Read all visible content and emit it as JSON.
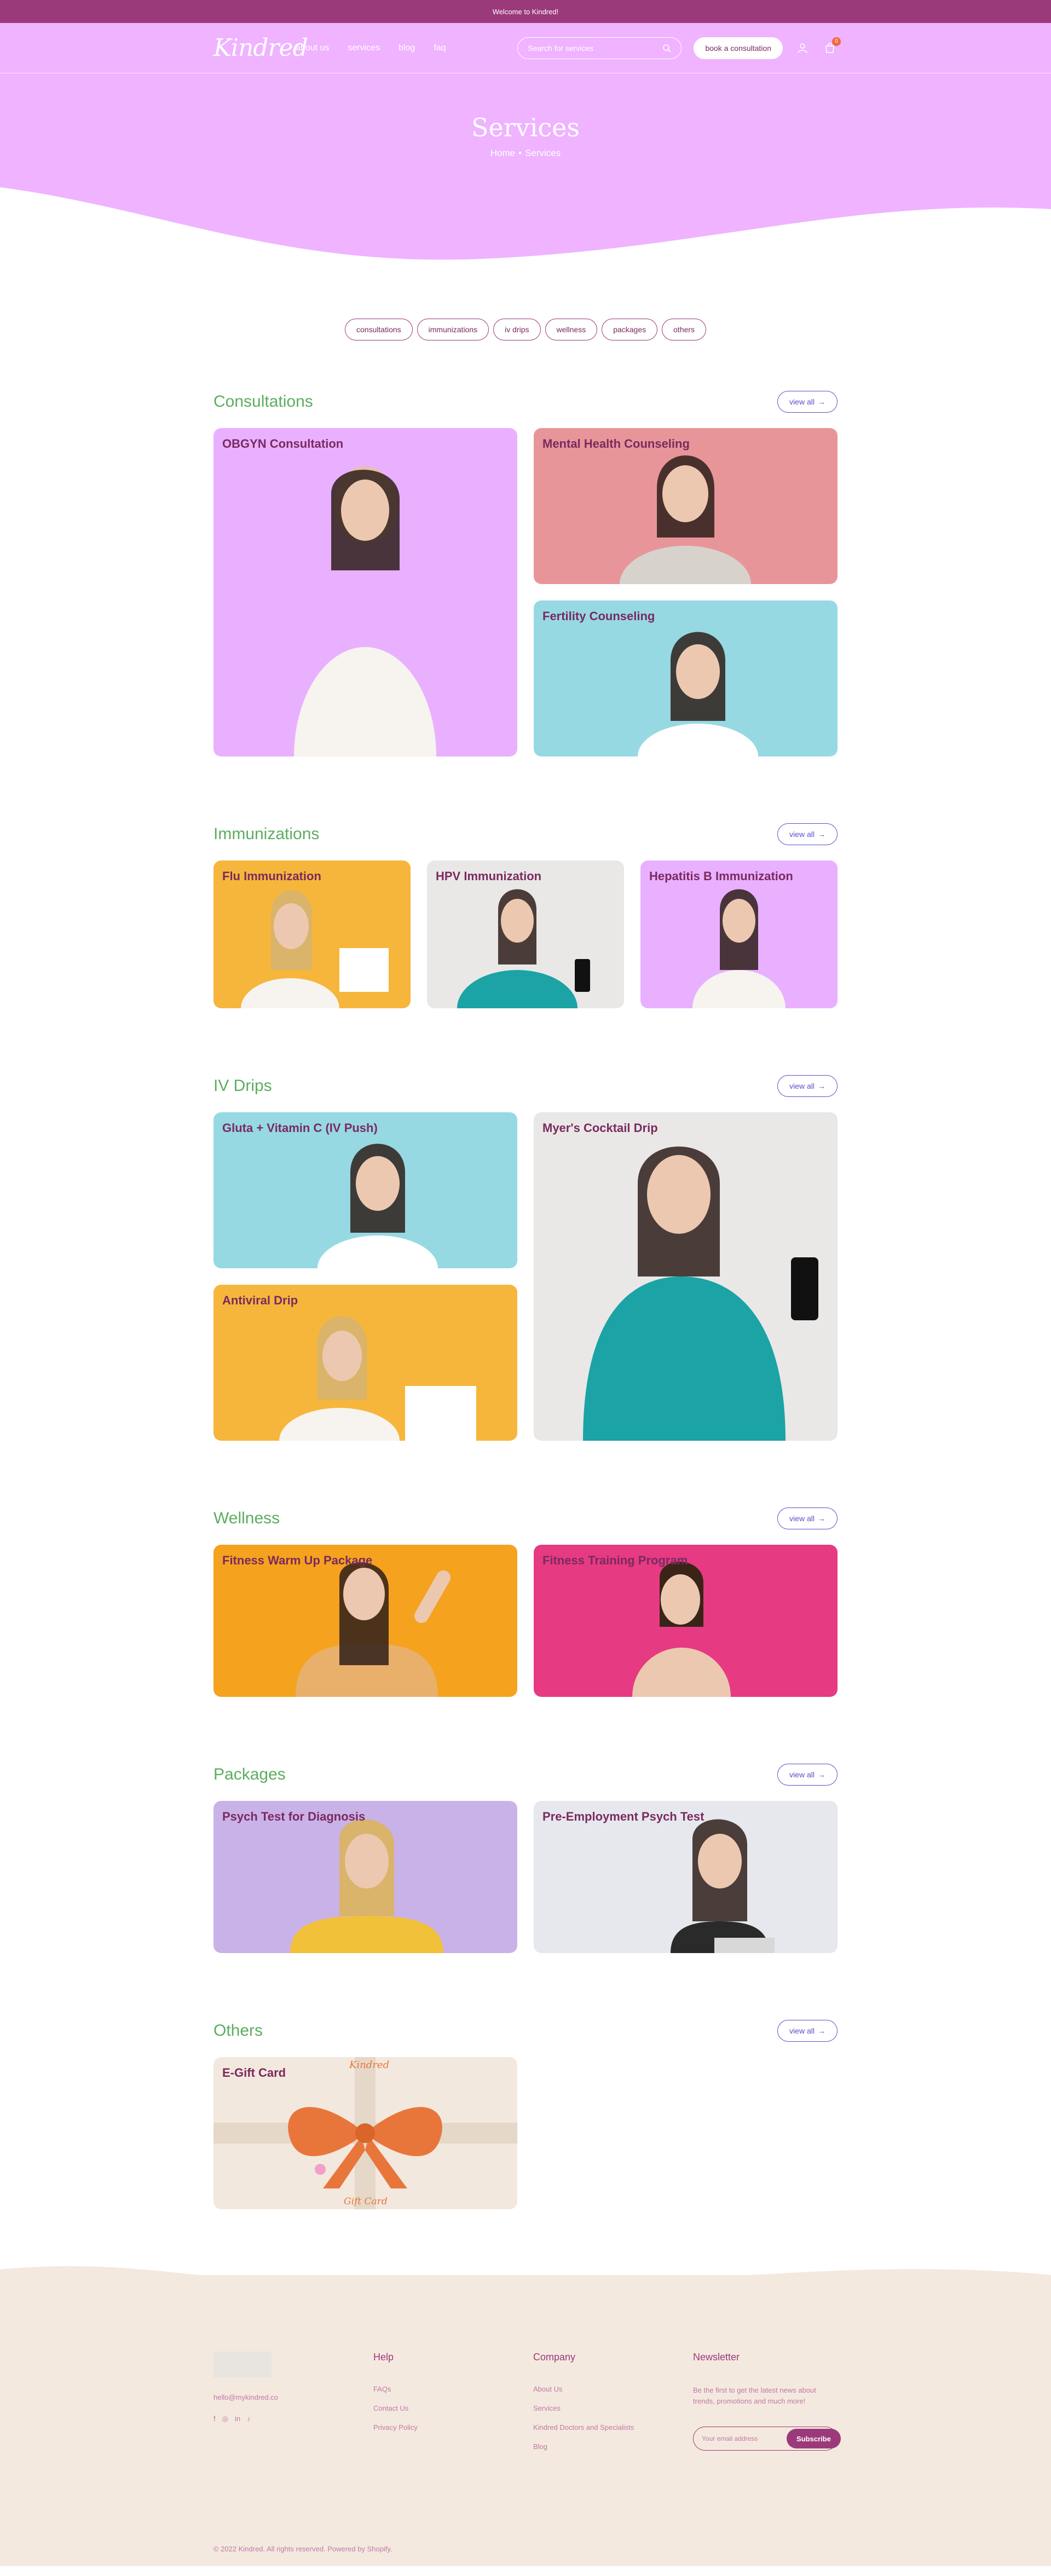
{
  "announcement": "Welcome to Kindred!",
  "brand": {
    "logo_text": "Kindred",
    "primary": "#9b3a7a",
    "hero_bg": "#efb3ff",
    "accent_green": "#5cad5f",
    "view_all_color": "#5a4fc9"
  },
  "nav": {
    "links": [
      "about us",
      "services",
      "blog",
      "faq"
    ],
    "search_placeholder": "Search for services",
    "book_label": "book a consultation",
    "cart_count": "0",
    "icons": [
      "search-icon",
      "user-icon",
      "cart-icon"
    ]
  },
  "hero": {
    "title": "Services",
    "breadcrumb_home": "Home",
    "breadcrumb_sep": "•",
    "breadcrumb_current": "Services"
  },
  "filters": [
    "consultations",
    "immunizations",
    "iv drips",
    "wellness",
    "packages",
    "others"
  ],
  "view_all_label": "view all",
  "sections": [
    {
      "title": "Consultations",
      "cards": [
        "OBGYN Consultation",
        "Mental Health Counseling",
        "Fertility Counseling"
      ]
    },
    {
      "title": "Immunizations",
      "cards": [
        "Flu Immunization",
        "HPV Immunization",
        "Hepatitis B Immunization"
      ]
    },
    {
      "title": "IV Drips",
      "cards": [
        "Gluta + Vitamin C (IV Push)",
        "Antiviral Drip",
        "Myer's Cocktail Drip"
      ]
    },
    {
      "title": "Wellness",
      "cards": [
        "Fitness Warm Up Package",
        "Fitness Training Program"
      ]
    },
    {
      "title": "Packages",
      "cards": [
        "Psych Test for Diagnosis",
        "Pre-Employment Psych Test"
      ]
    },
    {
      "title": "Others",
      "cards": [
        "E-Gift Card"
      ]
    }
  ],
  "gift_card": {
    "top_text": "Kindred",
    "bottom_text": "Gift Card"
  },
  "footer": {
    "email": "hello@mykindred.co",
    "social_icons": [
      "facebook-icon",
      "instagram-icon",
      "linkedin-icon",
      "tiktok-icon"
    ],
    "help": {
      "heading": "Help",
      "links": [
        "FAQs",
        "Contact Us",
        "Privacy Policy"
      ]
    },
    "company": {
      "heading": "Company",
      "links": [
        "About Us",
        "Services",
        "Kindred Doctors and Specialists",
        "Blog"
      ]
    },
    "newsletter": {
      "heading": "Newsletter",
      "text": "Be the first to get the latest news about trends, promotions and much more!",
      "placeholder": "Your email address",
      "button": "Subscribe"
    },
    "copyright": "© 2022 Kindred. All rights reserved. Powered by Shopify."
  }
}
